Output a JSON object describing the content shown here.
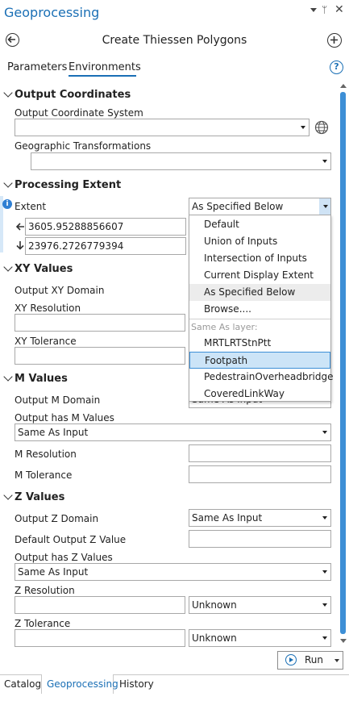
{
  "pane": {
    "title": "Geoprocessing",
    "tool_title": "Create Thiessen Polygons",
    "tabs": [
      "Parameters",
      "Environments"
    ],
    "active_tab": "Environments"
  },
  "sections": {
    "output_coordinates": {
      "title": "Output Coordinates",
      "ocs_label": "Output Coordinate System",
      "ocs_value": "",
      "geo_label": "Geographic Transformations",
      "geo_value": ""
    },
    "processing_extent": {
      "title": "Processing Extent",
      "extent_label": "Extent",
      "extent_value": "As Specified Below",
      "left_value": "3605.95288856607",
      "bottom_value": "23976.2726779394"
    },
    "xy_values": {
      "title": "XY Values",
      "domain_label": "Output XY Domain",
      "resolution_label": "XY Resolution",
      "tolerance_label": "XY Tolerance"
    },
    "m_values": {
      "title": "M Values",
      "domain_label": "Output M Domain",
      "domain_value": "Same As Input",
      "has_label": "Output has M Values",
      "has_value": "Same As Input",
      "resolution_label": "M Resolution",
      "tolerance_label": "M Tolerance"
    },
    "z_values": {
      "title": "Z Values",
      "domain_label": "Output Z Domain",
      "domain_value": "Same As Input",
      "default_label": "Default Output Z Value",
      "has_label": "Output has Z Values",
      "has_value": "Same As Input",
      "resolution_label": "Z Resolution",
      "resolution_unit": "Unknown",
      "tolerance_label": "Z Tolerance",
      "tolerance_unit": "Unknown"
    }
  },
  "dropdown": {
    "items": [
      "Default",
      "Union of Inputs",
      "Intersection of Inputs",
      "Current Display Extent",
      "As Specified Below",
      "Browse...."
    ],
    "group_label": "Same As layer:",
    "layers": [
      "MRTLRTStnPtt",
      "Footpath",
      "PedestrainOverheadbridge",
      "CoveredLinkWay"
    ],
    "highlighted": "Footpath",
    "selected": "As Specified Below"
  },
  "run_label": "Run",
  "bottom_tabs": [
    "Catalog",
    "Geoprocessing",
    "History"
  ],
  "colors": {
    "accent": "#1a6fb5",
    "highlight": "#cce4f7",
    "hover": "#e5e5e5"
  }
}
